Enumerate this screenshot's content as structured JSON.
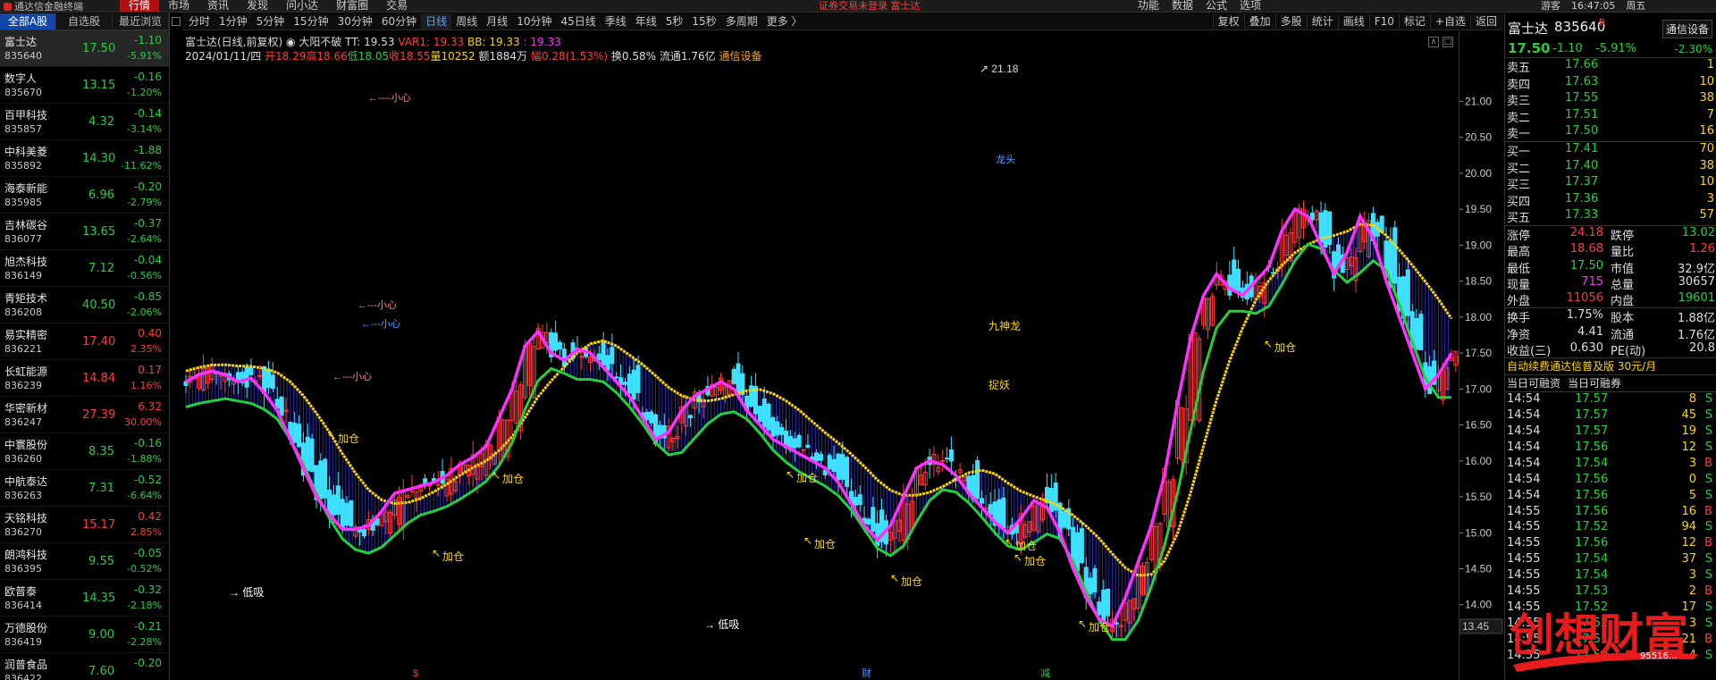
{
  "topbar": {
    "app": "通达信金融终端",
    "menu": [
      "行情",
      "市场",
      "资讯",
      "发现",
      "问小达",
      "财富圈",
      "交易"
    ],
    "warning": "证券交易未登录  富士达",
    "right_menu": [
      "功能",
      "数据",
      "公式",
      "选项"
    ],
    "right_menu2": [
      "游客",
      "16:47:05",
      "周五"
    ]
  },
  "left": {
    "tabs": [
      "全部A股",
      "自选股",
      "最近浏览"
    ],
    "stocks": [
      {
        "name": "富士达",
        "code": "835640",
        "price": "17.50",
        "chg": "-1.10",
        "pct": "-5.91%",
        "dir": "dn"
      },
      {
        "name": "数字人",
        "code": "835670",
        "price": "13.15",
        "chg": "-0.16",
        "pct": "-1.20%",
        "dir": "dn"
      },
      {
        "name": "百甲科技",
        "code": "835857",
        "price": "4.32",
        "chg": "-0.14",
        "pct": "-3.14%",
        "dir": "dn"
      },
      {
        "name": "中科美菱",
        "code": "835892",
        "price": "14.30",
        "chg": "-1.88",
        "pct": "-11.62%",
        "dir": "dn"
      },
      {
        "name": "海泰新能",
        "code": "835985",
        "price": "6.96",
        "chg": "-0.20",
        "pct": "-2.79%",
        "dir": "dn"
      },
      {
        "name": "吉林碳谷",
        "code": "836077",
        "price": "13.65",
        "chg": "-0.37",
        "pct": "-2.64%",
        "dir": "dn"
      },
      {
        "name": "旭杰科技",
        "code": "836149",
        "price": "7.12",
        "chg": "-0.04",
        "pct": "-0.56%",
        "dir": "dn"
      },
      {
        "name": "青矩技术",
        "code": "836208",
        "price": "40.50",
        "chg": "-0.85",
        "pct": "-2.06%",
        "dir": "dn"
      },
      {
        "name": "易实精密",
        "code": "836221",
        "price": "17.40",
        "chg": "0.40",
        "pct": "2.35%",
        "dir": "up"
      },
      {
        "name": "长虹能源",
        "code": "836239",
        "price": "14.84",
        "chg": "0.17",
        "pct": "1.16%",
        "dir": "up"
      },
      {
        "name": "华密新材",
        "code": "836247",
        "price": "27.39",
        "chg": "6.32",
        "pct": "30.00%",
        "dir": "up"
      },
      {
        "name": "中寰股份",
        "code": "836260",
        "price": "8.35",
        "chg": "-0.16",
        "pct": "-1.88%",
        "dir": "dn"
      },
      {
        "name": "中航泰达",
        "code": "836263",
        "price": "7.31",
        "chg": "-0.52",
        "pct": "-6.64%",
        "dir": "dn"
      },
      {
        "name": "天铭科技",
        "code": "836270",
        "price": "15.17",
        "chg": "0.42",
        "pct": "2.85%",
        "dir": "up"
      },
      {
        "name": "朗鸿科技",
        "code": "836395",
        "price": "9.55",
        "chg": "-0.05",
        "pct": "-0.52%",
        "dir": "dn"
      },
      {
        "name": "欧普泰",
        "code": "836414",
        "price": "14.35",
        "chg": "-0.32",
        "pct": "-2.18%",
        "dir": "dn"
      },
      {
        "name": "万德股份",
        "code": "836419",
        "price": "9.00",
        "chg": "-0.21",
        "pct": "-2.28%",
        "dir": "dn"
      },
      {
        "name": "润普食品",
        "code": "836422",
        "price": "7.60",
        "chg": "-0.20",
        "pct": "",
        "dir": "dn"
      }
    ]
  },
  "periods": [
    "分时",
    "1分钟",
    "5分钟",
    "15分钟",
    "30分钟",
    "60分钟",
    "日线",
    "周线",
    "月线",
    "10分钟",
    "45日线",
    "季线",
    "年线",
    "5秒",
    "15秒",
    "多周期",
    "更多 〉"
  ],
  "active_period": "日线",
  "tools": [
    "复权",
    "叠加",
    "多股",
    "统计",
    "画线",
    "F10",
    "标记",
    "+自选",
    "返回"
  ],
  "info": {
    "title": "富士达(日线,前复权)",
    "indicator": "大阳不破",
    "tt": "TT: 19.53",
    "var1": "VAR1: 19.33",
    "bb1": "BB: 19.33",
    "bb2": ": 19.33",
    "date": "2024/01/11/四",
    "open": "开18.29",
    "high": "高18.66",
    "low": "低18.05",
    "close": "收18.55",
    "vol": "量10252",
    "amt": "额1884万",
    "amp": "幅0.28(1.53%)",
    "turnover": "换0.58%",
    "float": "流通1.76亿",
    "industry": "通信设备"
  },
  "axis": {
    "ticks": [
      "21.00",
      "20.50",
      "20.00",
      "19.50",
      "19.00",
      "18.50",
      "18.00",
      "17.50",
      "17.00",
      "16.50",
      "16.00",
      "15.50",
      "15.00",
      "14.50",
      "14.00"
    ],
    "last_low": "13.45",
    "max_label": "21.18"
  },
  "annotations": {
    "jiacang": "加仓",
    "dixi": "→ 低吸",
    "xiaoxin": "小心",
    "longtou": "龙头",
    "zhaoyao": "捉妖",
    "jiushenlong": "九神龙",
    "markers": [
      "$",
      "财",
      "减"
    ]
  },
  "right": {
    "name": "富士达",
    "code": "835640",
    "r": "R",
    "industry_btn": "通信设备",
    "last": "17.50",
    "chg": "-1.10",
    "pct": "-5.91%",
    "pct2": "-2.30%",
    "asks": [
      {
        "label": "卖五",
        "price": "17.66",
        "vol": "1"
      },
      {
        "label": "卖四",
        "price": "17.63",
        "vol": "10"
      },
      {
        "label": "卖三",
        "price": "17.55",
        "vol": "38"
      },
      {
        "label": "卖二",
        "price": "17.51",
        "vol": "7"
      },
      {
        "label": "卖一",
        "price": "17.50",
        "vol": "16"
      }
    ],
    "bids": [
      {
        "label": "买一",
        "price": "17.41",
        "vol": "70"
      },
      {
        "label": "买二",
        "price": "17.40",
        "vol": "38"
      },
      {
        "label": "买三",
        "price": "17.37",
        "vol": "10"
      },
      {
        "label": "买四",
        "price": "17.36",
        "vol": "3"
      },
      {
        "label": "买五",
        "price": "17.33",
        "vol": "57"
      }
    ],
    "quote": [
      {
        "l1": "涨停",
        "v1": "24.18",
        "c1": "up",
        "l2": "跌停",
        "v2": "13.02",
        "c2": "dn"
      },
      {
        "l1": "最高",
        "v1": "18.68",
        "c1": "up",
        "l2": "量比",
        "v2": "1.26",
        "c2": "up"
      },
      {
        "l1": "最低",
        "v1": "17.50",
        "c1": "dn",
        "l2": "市值",
        "v2": "32.9亿",
        "c2": "wht"
      },
      {
        "l1": "现量",
        "v1": "715",
        "c1": "mag",
        "l2": "总量",
        "v2": "30657",
        "c2": "wht"
      },
      {
        "l1": "外盘",
        "v1": "11056",
        "c1": "up",
        "l2": "内盘",
        "v2": "19601",
        "c2": "dn"
      }
    ],
    "quote2": [
      {
        "l1": "换手",
        "v1": "1.75%",
        "l2": "股本",
        "v2": "1.88亿"
      },
      {
        "l1": "净资",
        "v1": "4.41",
        "l2": "流通",
        "v2": "1.76亿"
      },
      {
        "l1": "收益(三)",
        "v1": "0.630",
        "l2": "PE(动)",
        "v2": "20.8"
      }
    ],
    "banner": "自动续费通达信普及版  30元/月",
    "tabs": [
      "当日可融资",
      "当日可融券"
    ],
    "trades": [
      {
        "t": "14:54",
        "p": "17.57",
        "v": "8",
        "d": "S"
      },
      {
        "t": "14:54",
        "p": "17.57",
        "v": "45",
        "d": "S"
      },
      {
        "t": "14:54",
        "p": "17.57",
        "v": "19",
        "d": "S"
      },
      {
        "t": "14:54",
        "p": "17.56",
        "v": "12",
        "d": "S"
      },
      {
        "t": "14:54",
        "p": "17.54",
        "v": "3",
        "d": "B"
      },
      {
        "t": "14:54",
        "p": "17.56",
        "v": "0",
        "d": "S"
      },
      {
        "t": "14:54",
        "p": "17.56",
        "v": "5",
        "d": "S"
      },
      {
        "t": "14:55",
        "p": "17.56",
        "v": "16",
        "d": "B"
      },
      {
        "t": "14:55",
        "p": "17.52",
        "v": "94",
        "d": "S"
      },
      {
        "t": "14:55",
        "p": "17.56",
        "v": "12",
        "d": "B"
      },
      {
        "t": "14:55",
        "p": "17.54",
        "v": "37",
        "d": "S"
      },
      {
        "t": "14:55",
        "p": "17.54",
        "v": "3",
        "d": "S"
      },
      {
        "t": "14:55",
        "p": "17.53",
        "v": "2",
        "d": "B"
      },
      {
        "t": "14:55",
        "p": "17.52",
        "v": "17",
        "d": "S"
      },
      {
        "t": "14:55",
        "p": "17.52",
        "v": "3",
        "d": "S"
      },
      {
        "t": "14:55",
        "p": "17.51",
        "v": "21",
        "d": "B"
      },
      {
        "t": "14:55",
        "p": "17.50",
        "v": "4",
        "d": "S"
      }
    ],
    "watermark": "创想财富",
    "watermark_sub": "95516..."
  },
  "chart_data": {
    "type": "candlestick",
    "ylim": [
      13.45,
      21.18
    ],
    "yticks": [
      14.0,
      14.5,
      15.0,
      15.5,
      16.0,
      16.5,
      17.0,
      17.5,
      18.0,
      18.5,
      19.0,
      19.5,
      20.0,
      20.5,
      21.0
    ],
    "close_series": [
      17.1,
      17.2,
      17.25,
      17.2,
      17.1,
      17.15,
      16.95,
      16.7,
      16.3,
      15.9,
      15.5,
      15.25,
      15.05,
      15.05,
      15.1,
      15.3,
      15.55,
      15.6,
      15.65,
      15.7,
      15.8,
      15.95,
      16.05,
      16.2,
      16.6,
      17.0,
      17.6,
      17.8,
      17.5,
      17.4,
      17.55,
      17.5,
      17.3,
      17.1,
      16.9,
      16.6,
      16.3,
      16.4,
      16.7,
      16.9,
      17.0,
      17.1,
      17.0,
      16.7,
      16.5,
      16.3,
      16.2,
      16.1,
      16.0,
      15.9,
      15.7,
      15.4,
      15.1,
      14.9,
      15.1,
      15.5,
      15.9,
      16.0,
      15.95,
      15.8,
      15.55,
      15.35,
      15.15,
      15.0,
      15.2,
      15.45,
      15.35,
      15.0,
      14.5,
      14.1,
      13.8,
      13.7,
      14.1,
      14.6,
      15.1,
      15.8,
      16.8,
      17.7,
      18.3,
      18.6,
      18.4,
      18.3,
      18.5,
      18.7,
      19.2,
      19.5,
      19.4,
      19.0,
      18.6,
      18.9,
      19.4,
      19.1,
      18.5,
      18.0,
      17.5,
      17.0,
      17.2,
      17.5
    ],
    "series": [
      {
        "name": "BB",
        "color": "#ffd400"
      },
      {
        "name": "VAR1",
        "color": "#ff30ff"
      },
      {
        "name": "TT",
        "color": "#23d13d"
      }
    ]
  }
}
